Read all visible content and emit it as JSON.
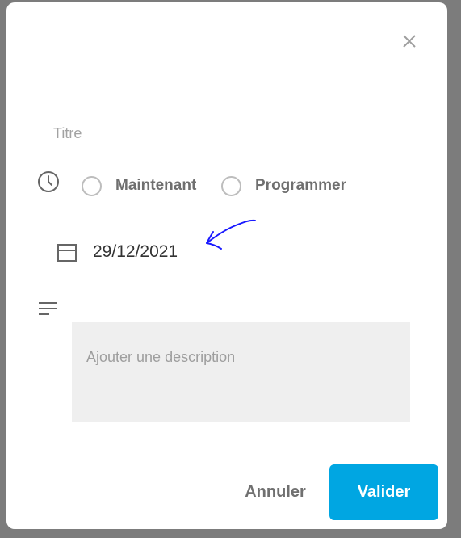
{
  "dialog": {
    "close_icon": "close-icon",
    "title_field": {
      "placeholder": "Titre",
      "value": ""
    },
    "schedule": {
      "icon": "clock-icon",
      "options": [
        {
          "label": "Maintenant",
          "selected": false
        },
        {
          "label": "Programmer",
          "selected": false
        }
      ]
    },
    "date": {
      "icon": "calendar-icon",
      "value": "29/12/2021"
    },
    "description": {
      "icon": "notes-lines-icon",
      "placeholder": "Ajouter une description",
      "value": ""
    },
    "actions": {
      "cancel_label": "Annuler",
      "submit_label": "Valider"
    }
  },
  "colors": {
    "accent": "#00a6e2",
    "annotation": "#1a1aff",
    "input_background": "#efefef",
    "backdrop": "#7c7c7c"
  }
}
